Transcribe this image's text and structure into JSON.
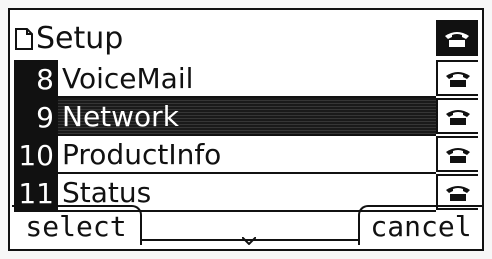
{
  "title": {
    "text": "Setup",
    "icon": "document-icon"
  },
  "menu": {
    "items": [
      {
        "number": "8",
        "label": "VoiceMail",
        "selected": false
      },
      {
        "number": "9",
        "label": "Network",
        "selected": true
      },
      {
        "number": "10",
        "label": "ProductInfo",
        "selected": false
      },
      {
        "number": "11",
        "label": "Status",
        "selected": false
      }
    ]
  },
  "line_keys": [
    {
      "icon": "phone-icon",
      "active": true
    },
    {
      "icon": "phone-icon",
      "active": false
    },
    {
      "icon": "phone-icon",
      "active": false
    },
    {
      "icon": "phone-icon",
      "active": false
    },
    {
      "icon": "phone-icon",
      "active": false
    }
  ],
  "softkeys": {
    "left_label": "select",
    "right_label": "cancel"
  },
  "colors": {
    "foreground": "#111111",
    "background": "#ffffff"
  }
}
